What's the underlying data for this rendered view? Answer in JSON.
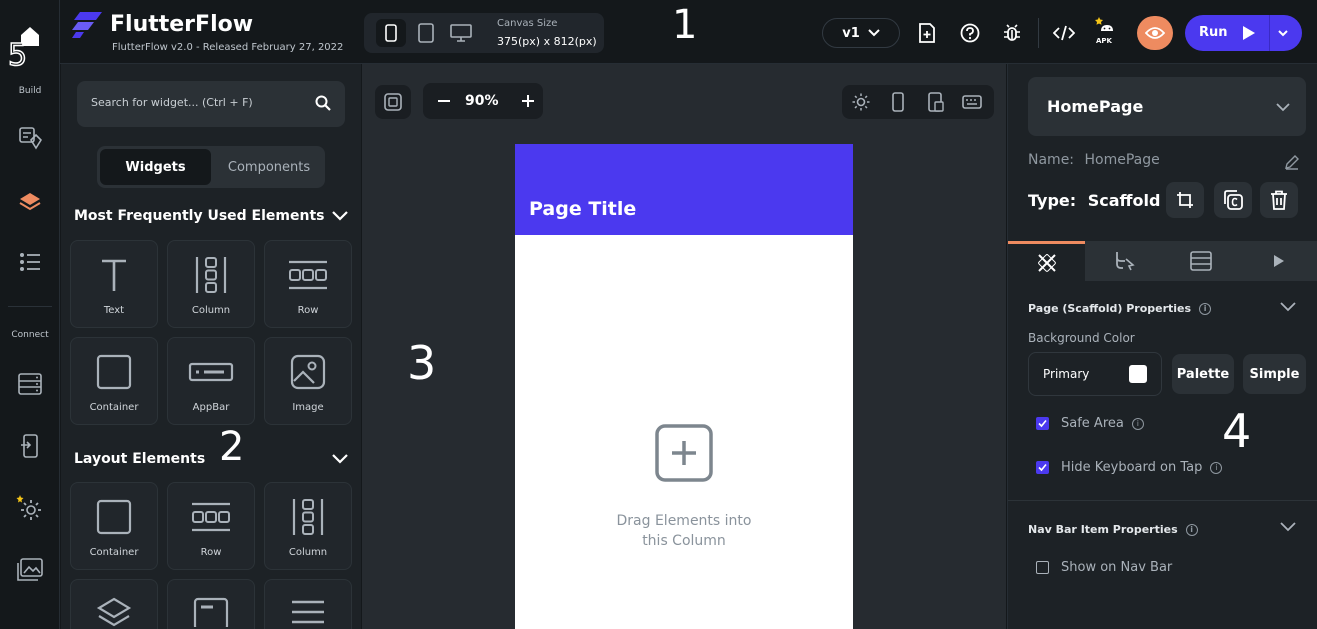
{
  "header": {
    "brand": "FlutterFlow",
    "release": "FlutterFlow v2.0 - Released February 27, 2022",
    "canvas_size_label": "Canvas Size",
    "canvas_size_value": "375(px) x 812(px)",
    "version": "v1",
    "apk_label": "APK",
    "run_label": "Run"
  },
  "rail": {
    "build_label": "Build",
    "connect_label": "Connect"
  },
  "widget_panel": {
    "search_placeholder": "Search for widget... (Ctrl + F)",
    "tab_widgets": "Widgets",
    "tab_components": "Components",
    "section_frequent": "Most Frequently Used Elements",
    "frequent_items": [
      "Text",
      "Column",
      "Row",
      "Container",
      "AppBar",
      "Image"
    ],
    "section_layout": "Layout Elements",
    "layout_items": [
      "Container",
      "Row",
      "Column"
    ]
  },
  "canvas": {
    "zoom": "90%",
    "page_title": "Page Title",
    "drag_hint_1": "Drag Elements into",
    "drag_hint_2": "this Column"
  },
  "properties": {
    "page_name": "HomePage",
    "name_label": "Name:",
    "name_value": "HomePage",
    "type_label": "Type:",
    "type_value": "Scaffold",
    "section_page": "Page (Scaffold) Properties",
    "bg_color_label": "Background Color",
    "bg_color_value": "Primary",
    "palette_label": "Palette",
    "simple_label": "Simple",
    "safe_area": "Safe Area",
    "hide_keyboard": "Hide Keyboard on Tap",
    "section_nav": "Nav Bar Item Properties",
    "show_nav": "Show on Nav Bar"
  },
  "annotations": [
    "1",
    "2",
    "3",
    "4",
    "5"
  ],
  "colors": {
    "accent": "#4b39ef",
    "secondary": "#ee8b60",
    "background": "#14181b"
  }
}
